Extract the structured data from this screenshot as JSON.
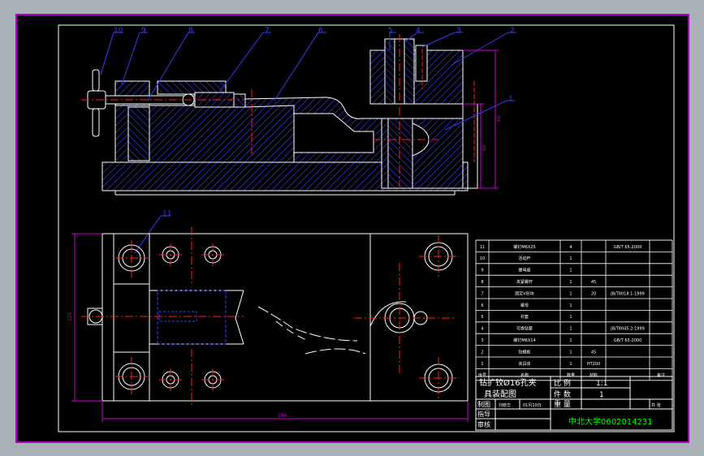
{
  "colors": {
    "background": "#000000",
    "frame_outer": "#b000c0",
    "border": "#ffffff",
    "hatch": "#3a3ad8",
    "center": "#ff2020",
    "leader": "#3a3aff",
    "dim": "#d000d0",
    "title_green": "#00ff00",
    "table_white": "#ffffff"
  },
  "balloons": [
    "10",
    "9",
    "8",
    "7",
    "6",
    "5",
    "4",
    "3",
    "2",
    "1",
    "11"
  ],
  "dims": {
    "right_height_a": "60",
    "right_height_b": "80",
    "left_height": "125",
    "bottom_length": "284"
  },
  "bom": {
    "rows": [
      {
        "no": "11",
        "name": "螺钉M6X25",
        "qty": "4",
        "mat": "",
        "std": "GB/T 65-2000",
        "note": ""
      },
      {
        "no": "10",
        "name": "活动杆",
        "qty": "1",
        "mat": "",
        "std": "",
        "note": ""
      },
      {
        "no": "9",
        "name": "螺母座",
        "qty": "1",
        "mat": "",
        "std": "",
        "note": ""
      },
      {
        "no": "8",
        "name": "夹紧螺杆",
        "qty": "1",
        "mat": "45",
        "std": "",
        "note": ""
      },
      {
        "no": "7",
        "name": "固定V形块",
        "qty": "1",
        "mat": "20",
        "std": "JB/T8018.1-1999",
        "note": ""
      },
      {
        "no": "6",
        "name": "螺母",
        "qty": "1",
        "mat": "",
        "std": "",
        "note": ""
      },
      {
        "no": "5",
        "name": "衬套",
        "qty": "1",
        "mat": "",
        "std": "",
        "note": ""
      },
      {
        "no": "4",
        "name": "可换钻套",
        "qty": "1",
        "mat": "",
        "std": "JB/T8045.2-1999",
        "note": ""
      },
      {
        "no": "3",
        "name": "螺钉M6X14",
        "qty": "1",
        "mat": "",
        "std": "GB/T 65-2000",
        "note": ""
      },
      {
        "no": "2",
        "name": "钻模板",
        "qty": "1",
        "mat": "45",
        "std": "",
        "note": ""
      },
      {
        "no": "1",
        "name": "夹具体",
        "qty": "1",
        "mat": "HT200",
        "std": "",
        "note": ""
      }
    ],
    "header": {
      "no": "序号",
      "name": "名称",
      "qty": "数量",
      "mat": "材料",
      "std": "",
      "note": "备注"
    }
  },
  "title_block": {
    "drawing_title_1": "钻扩铰Ø16孔夹",
    "drawing_title_2": "具装配图",
    "scale_label": "比 例",
    "scale_value": "1:1",
    "count_label": "件 数",
    "count_value": "1",
    "weight_label": "重 量",
    "sheet_label": "共 张",
    "draw_label": "制图",
    "drawer_name": "刘晓华",
    "draw_date": "01月10日",
    "guide_label": "指导",
    "review_label": "审核",
    "school": "中北大学0602014231"
  }
}
